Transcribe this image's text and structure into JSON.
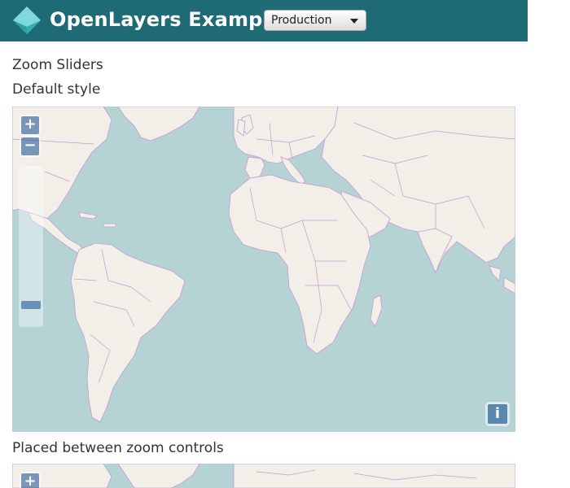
{
  "header": {
    "brand": "OpenLayers Examples",
    "version_select": "Production"
  },
  "page": {
    "title": "Zoom Sliders",
    "section1": "Default style",
    "section2": "Placed between zoom controls"
  },
  "map1": {
    "zoom_in": "+",
    "zoom_out": "−",
    "attribution": "i",
    "slider_level": 0.9
  },
  "map2": {
    "zoom_in": "+"
  },
  "colors": {
    "navbar": "#1f6b75",
    "ocean": "#b5d3d5",
    "land": "#f2efe9",
    "borders": "#c69ad0",
    "controls": "rgba(0,60,136,0.5)"
  }
}
